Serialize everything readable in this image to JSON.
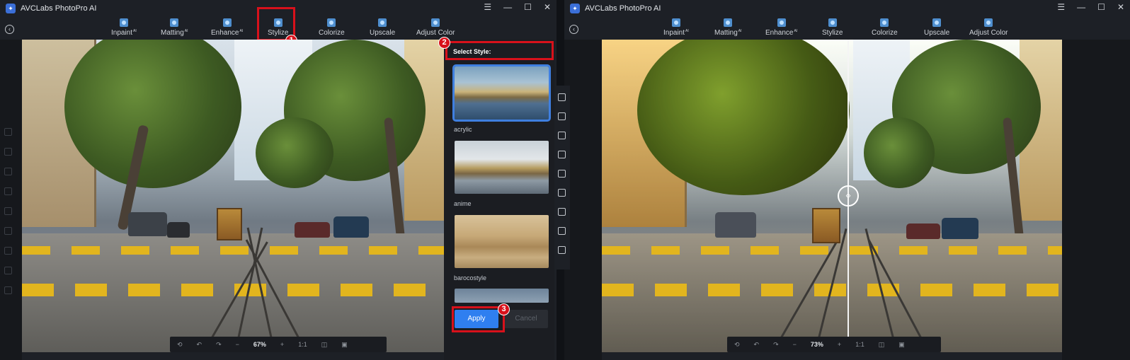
{
  "app": {
    "title": "AVCLabs PhotoPro AI"
  },
  "window_controls": {
    "menu": "☰",
    "minimize": "—",
    "maximize": "☐",
    "close": "✕"
  },
  "toolbar": {
    "tools": [
      {
        "label": "Inpaint",
        "sup": "AI"
      },
      {
        "label": "Matting",
        "sup": "AI"
      },
      {
        "label": "Enhance",
        "sup": "AI"
      },
      {
        "label": "Stylize",
        "sup": ""
      },
      {
        "label": "Colorize",
        "sup": ""
      },
      {
        "label": "Upscale",
        "sup": ""
      },
      {
        "label": "Adjust Color",
        "sup": ""
      }
    ]
  },
  "steps": {
    "one": "1",
    "two": "2",
    "three": "3"
  },
  "style_panel": {
    "title": "Select Style:",
    "styles": [
      "acrylic",
      "anime",
      "barocostyle"
    ],
    "apply_label": "Apply",
    "cancel_label": "Cancel"
  },
  "left_zoom": {
    "value": "67%",
    "minus": "−",
    "plus": "+",
    "ratio": "1:1"
  },
  "right_zoom": {
    "value": "73%",
    "minus": "−",
    "plus": "+",
    "ratio": "1:1"
  },
  "compare_handle": "‹›",
  "colors": {
    "accent": "#2f7ff0",
    "highlight": "#d8111b",
    "bg": "#1d2026"
  }
}
